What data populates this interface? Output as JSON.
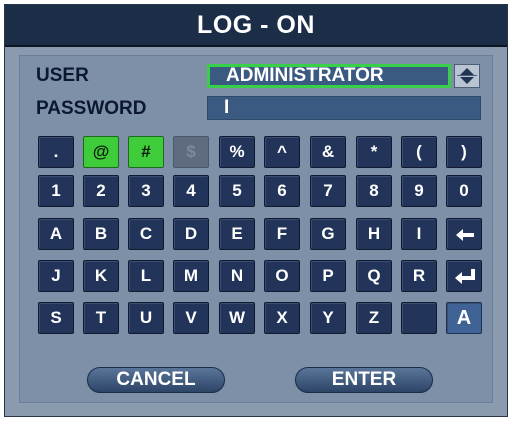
{
  "title": "LOG - ON",
  "user": {
    "label": "USER",
    "value": "ADMINISTRATOR"
  },
  "password": {
    "label": "PASSWORD",
    "value": "I"
  },
  "keyboard": {
    "row1": [
      ".",
      "@",
      "#",
      "$",
      "%",
      "^",
      "&",
      "*",
      "(",
      ")"
    ],
    "row2": [
      "1",
      "2",
      "3",
      "4",
      "5",
      "6",
      "7",
      "8",
      "9",
      "0"
    ],
    "row3": [
      "A",
      "B",
      "C",
      "D",
      "E",
      "F",
      "G",
      "H",
      "I"
    ],
    "row4": [
      "J",
      "K",
      "L",
      "M",
      "N",
      "O",
      "P",
      "Q",
      "R"
    ],
    "row5": [
      "S",
      "T",
      "U",
      "V",
      "W",
      "X",
      "Y",
      "Z"
    ],
    "case_key": "A",
    "icons": {
      "backspace": "backspace-arrow-icon",
      "enter": "enter-return-icon"
    }
  },
  "buttons": {
    "cancel": "CANCEL",
    "enter": "ENTER"
  },
  "colors": {
    "title_bg": "#1c2d47",
    "panel_bg": "#7e90a7",
    "key_bg": "#22345a",
    "highlight": "#3fcc3a",
    "field_bg": "#3b5a82"
  }
}
